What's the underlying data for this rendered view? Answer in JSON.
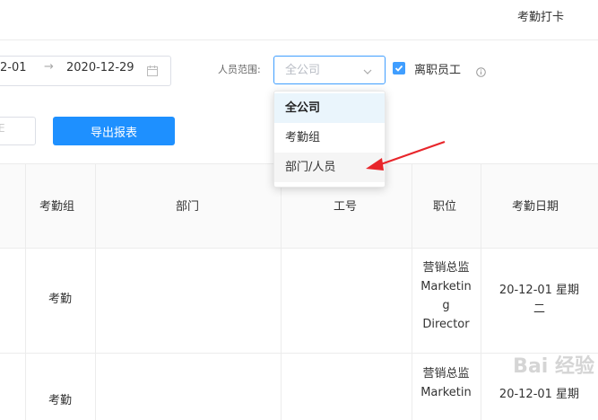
{
  "header": {
    "title": "考勤打卡"
  },
  "filters": {
    "date_start": "2-01",
    "date_separator": "→",
    "date_end": "2020-12-29",
    "scope_label": "人员范围:",
    "scope_value": "全公司",
    "departed_label": "离职员工",
    "departed_checked": true
  },
  "dropdown": {
    "options": [
      {
        "label": "全公司",
        "selected": true
      },
      {
        "label": "考勤组",
        "selected": false
      },
      {
        "label": "部门/人员",
        "selected": false
      }
    ]
  },
  "toolbar": {
    "left_input_fragment": "E",
    "export_label": "导出报表"
  },
  "table": {
    "columns": [
      "考勤组",
      "部门",
      "工号",
      "职位",
      "考勤日期"
    ],
    "rows": [
      {
        "group": "考勤",
        "dept": "",
        "id": "",
        "position": [
          "营销总监",
          "Marketin",
          "g",
          "Director"
        ],
        "date": [
          "20-12-01 星期",
          "二"
        ]
      },
      {
        "group": "考勤",
        "dept": "",
        "id": "",
        "position": [
          "营销总监",
          "Marketin"
        ],
        "date": [
          "20-12-01 星期"
        ]
      }
    ]
  },
  "watermark": "Bai 经验",
  "colors": {
    "accent": "#409eff",
    "button": "#1e90ff",
    "arrow": "#e8262b"
  }
}
